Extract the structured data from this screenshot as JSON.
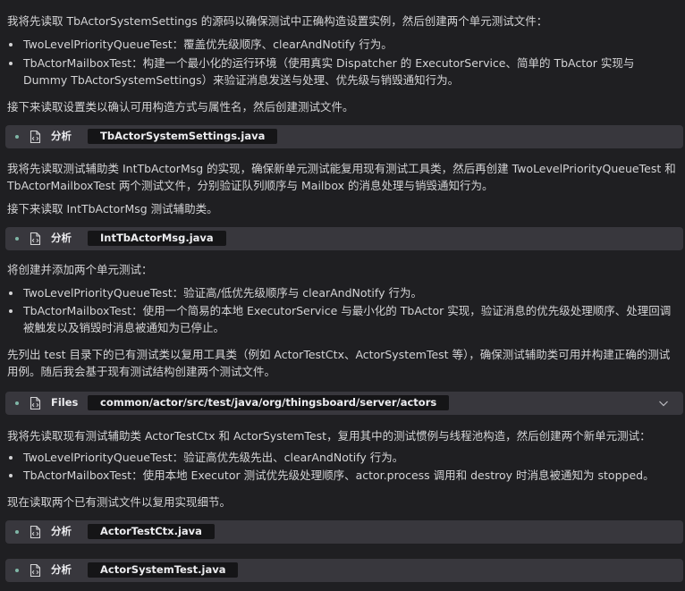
{
  "paragraphs": {
    "p1": "我将先读取 TbActorSystemSettings 的源码以确保测试中正确构造设置实例，然后创建两个单元测试文件：",
    "p2": "接下来读取设置类以确认可用构造方式与属性名，然后创建测试文件。",
    "p3": "我将先读取测试辅助类 IntTbActorMsg 的实现，确保新单元测试能复用现有测试工具类，然后再创建 TwoLevelPriorityQueueTest 和 TbActorMailboxTest 两个测试文件，分别验证队列顺序与 Mailbox 的消息处理与销毁通知行为。",
    "p4": "接下来读取 IntTbActorMsg 测试辅助类。",
    "p5": "将创建并添加两个单元测试：",
    "p6": "先列出 test 目录下的已有测试类以复用工具类（例如 ActorTestCtx、ActorSystemTest 等），确保测试辅助类可用并构建正确的测试用例。随后我会基于现有测试结构创建两个测试文件。",
    "p7": "我将先读取现有测试辅助类 ActorTestCtx 和 ActorSystemTest，复用其中的测试惯例与线程池构造，然后创建两个新单元测试：",
    "p8": "现在读取两个已有测试文件以复用实现细节。"
  },
  "bullets": {
    "b1": "TwoLevelPriorityQueueTest：覆盖优先级顺序、clearAndNotify 行为。",
    "b2": "TbActorMailboxTest：构建一个最小化的运行环境（使用真实 Dispatcher 的 ExecutorService、简单的 TbActor 实现与 Dummy TbActorSystemSettings）来验证消息发送与处理、优先级与销毁通知行为。",
    "b3": "TwoLevelPriorityQueueTest：验证高/低优先级顺序与 clearAndNotify 行为。",
    "b4": "TbActorMailboxTest：使用一个简易的本地 ExecutorService 与最小化的 TbActor 实现，验证消息的优先级处理顺序、处理回调被触发以及销毁时消息被通知为已停止。",
    "b5": "TwoLevelPriorityQueueTest：验证高优先级先出、clearAndNotify 行为。",
    "b6": "TbActorMailboxTest：使用本地 Executor 测试优先级处理顺序、actor.process 调用和 destroy 时消息被通知为 stopped。"
  },
  "tools": [
    {
      "label": "分析",
      "target": "TbActorSystemSettings.java",
      "icon": "file-code-icon"
    },
    {
      "label": "分析",
      "target": "IntTbActorMsg.java",
      "icon": "file-code-icon"
    },
    {
      "label": "Files",
      "target": "common/actor/src/test/java/org/thingsboard/server/actors",
      "icon": "file-code-icon",
      "chevron": "chevron-down-icon"
    },
    {
      "label": "分析",
      "target": "ActorTestCtx.java",
      "icon": "file-code-icon"
    },
    {
      "label": "分析",
      "target": "ActorSystemTest.java",
      "icon": "file-code-icon"
    }
  ],
  "colors": {
    "background": "#1f1f22",
    "text": "#d4d4d6",
    "tool_row": "#38373d",
    "chip": "#151517",
    "status_dot": "#7fb6a6"
  }
}
